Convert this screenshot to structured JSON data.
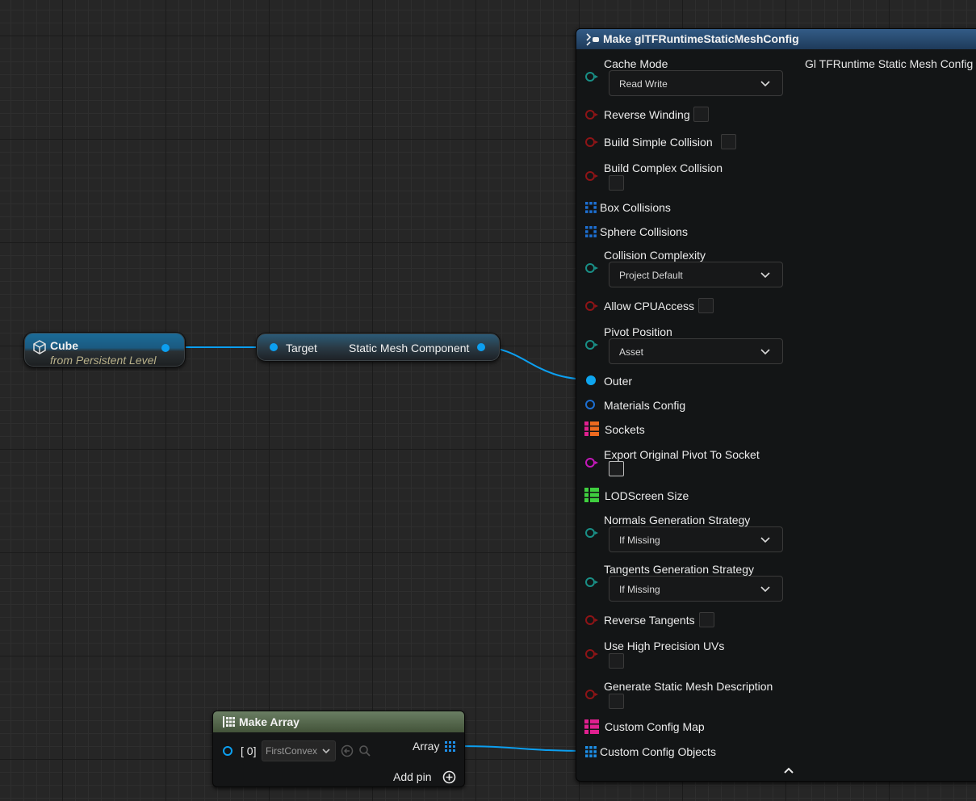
{
  "colors": {
    "exec_blue": "#0c9ff0",
    "byte_teal": "#198f86",
    "bool_red": "#8e1416",
    "struct_blue": "#1d6fd2",
    "array_orange": "#ee6a1f",
    "array_magenta": "#e0208f",
    "array_green": "#3fcf3f",
    "set_magenta": "#c418b9"
  },
  "cube_node": {
    "title": "Cube",
    "subtitle": "from Persistent Level",
    "icon": "cube-icon"
  },
  "getter_node": {
    "input_label": "Target",
    "output_label": "Static Mesh Component"
  },
  "make_array_node": {
    "title": "Make Array",
    "icon": "array-grid-icon",
    "index_label": "[ 0]",
    "element_value": "FirstConvex",
    "output_label": "Array",
    "add_pin_label": "Add pin"
  },
  "make_node": {
    "title": "Make glTFRuntimeStaticMeshConfig",
    "output_label": "Gl TFRuntime Static Mesh Config",
    "params": {
      "cache_mode": {
        "label": "Cache Mode",
        "value": "Read Write"
      },
      "reverse_winding": {
        "label": "Reverse Winding"
      },
      "build_simple_collision": {
        "label": "Build Simple Collision"
      },
      "build_complex_collision": {
        "label": "Build Complex Collision"
      },
      "box_collisions": {
        "label": "Box Collisions"
      },
      "sphere_collisions": {
        "label": "Sphere Collisions"
      },
      "collision_complexity": {
        "label": "Collision Complexity",
        "value": "Project Default"
      },
      "allow_cpu_access": {
        "label": "Allow CPUAccess"
      },
      "pivot_position": {
        "label": "Pivot Position",
        "value": "Asset"
      },
      "outer": {
        "label": "Outer"
      },
      "materials_config": {
        "label": "Materials Config"
      },
      "sockets": {
        "label": "Sockets"
      },
      "export_original_pivot": {
        "label": "Export Original Pivot To Socket"
      },
      "lod_screen_size": {
        "label": "LODScreen Size"
      },
      "normals_strategy": {
        "label": "Normals Generation Strategy",
        "value": "If Missing"
      },
      "tangents_strategy": {
        "label": "Tangents Generation Strategy",
        "value": "If Missing"
      },
      "reverse_tangents": {
        "label": "Reverse Tangents"
      },
      "use_high_precision_uvs": {
        "label": "Use High Precision UVs"
      },
      "generate_static_mesh_description": {
        "label": "Generate Static Mesh Description"
      },
      "custom_config_map": {
        "label": "Custom Config Map"
      },
      "custom_config_objects": {
        "label": "Custom Config Objects"
      }
    }
  }
}
